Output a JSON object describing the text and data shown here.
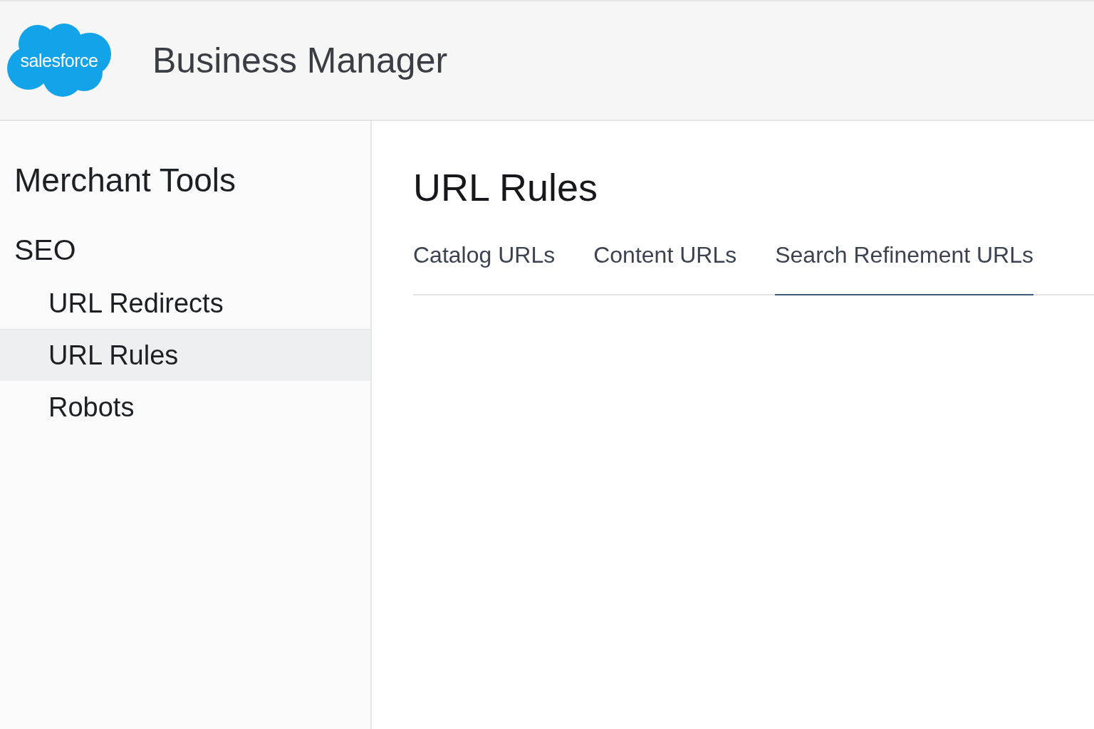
{
  "header": {
    "logo_text": "salesforce",
    "title": "Business Manager"
  },
  "sidebar": {
    "heading": "Merchant Tools",
    "section": "SEO",
    "items": [
      {
        "label": "URL Redirects",
        "selected": false
      },
      {
        "label": "URL Rules",
        "selected": true
      },
      {
        "label": "Robots",
        "selected": false
      }
    ]
  },
  "main": {
    "title": "URL Rules",
    "tabs": [
      {
        "label": "Catalog URLs",
        "selected": false
      },
      {
        "label": "Content URLs",
        "selected": false
      },
      {
        "label": "Search Refinement URLs",
        "selected": true
      }
    ]
  }
}
